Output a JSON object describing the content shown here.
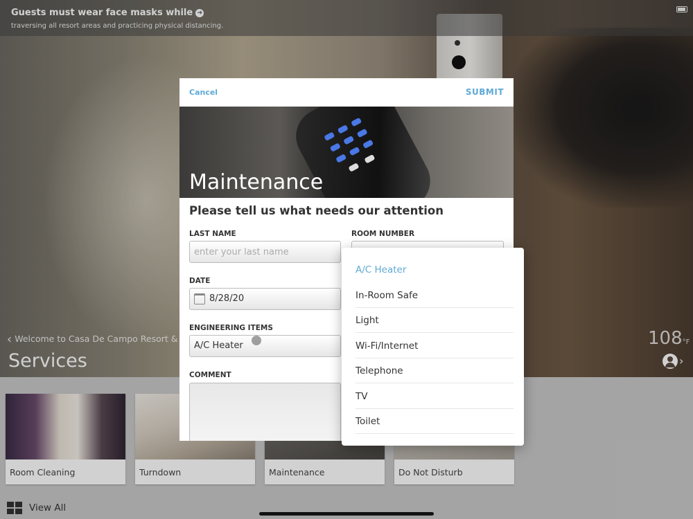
{
  "status_bar": {
    "notice_title": "Guests must wear face masks while",
    "notice_subtitle": "traversing all resort areas and practicing physical distancing."
  },
  "header": {
    "back_label": "Welcome to Casa De Campo Resort & Villas",
    "page_title": "Services",
    "temperature": "108",
    "temperature_unit": "°F"
  },
  "cards": [
    {
      "label": "Room Cleaning"
    },
    {
      "label": "Turndown"
    },
    {
      "label": "Maintenance"
    },
    {
      "label": "Do Not Disturb"
    }
  ],
  "view_all_label": "View All",
  "modal": {
    "cancel_label": "Cancel",
    "submit_label": "SUBMIT",
    "banner_title": "Maintenance",
    "prompt": "Please tell us what needs our attention",
    "last_name_label": "LAST NAME",
    "last_name_placeholder": "enter your last name",
    "room_number_label": "ROOM NUMBER",
    "date_label": "DATE",
    "date_value": "8/28/20",
    "engineering_label": "ENGINEERING ITEMS",
    "engineering_value": "A/C Heater",
    "comment_label": "COMMENT"
  },
  "dropdown": {
    "options": [
      "A/C Heater",
      "In-Room Safe",
      "Light",
      "Wi-Fi/Internet",
      "Telephone",
      "TV",
      "Toilet"
    ],
    "selected": "A/C Heater"
  },
  "colors": {
    "accent": "#5fa9d6"
  }
}
